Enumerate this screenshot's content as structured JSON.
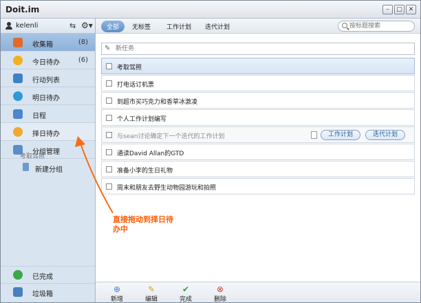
{
  "app": {
    "title": "Doit.im"
  },
  "user": {
    "name": "kelenli"
  },
  "sidebar": {
    "items": [
      {
        "label": "收集箱",
        "count": "(8)",
        "color": "#e06a2b"
      },
      {
        "label": "今日待办",
        "count": "(6)",
        "color": "#f2b01e"
      },
      {
        "label": "行动列表",
        "count": "",
        "color": "#3f7fc8"
      },
      {
        "label": "明日待办",
        "count": "",
        "color": "#2f9ad8"
      },
      {
        "label": "日程",
        "count": "",
        "color": "#4b86cf"
      },
      {
        "label": "择日待办",
        "count": "",
        "color": "#f0a830"
      },
      {
        "label": "分组管理",
        "count": "",
        "color": "#5b8ec7"
      }
    ],
    "sub_item": {
      "label": "新建分组"
    },
    "drag_ghost": "考取驾照",
    "completed": {
      "label": "已完成"
    },
    "trash": {
      "label": "垃圾箱"
    }
  },
  "filters": {
    "tags": [
      "全部",
      "无标签",
      "工作计划",
      "迭代计划"
    ],
    "search_placeholder": "按标题搜索"
  },
  "new_task": {
    "placeholder": "新任务"
  },
  "tasks": [
    {
      "text": "考取驾照"
    },
    {
      "text": "打电话订机票"
    },
    {
      "text": "到超市买巧克力和香草冰激凌"
    },
    {
      "text": "个人工作计划编写"
    },
    {
      "text": "与sean讨论确定下一个迭代的工作计划",
      "tags": [
        "工作计划",
        "迭代计划"
      ]
    },
    {
      "text": "通读David Allan的GTD"
    },
    {
      "text": "准备小李的生日礼物"
    },
    {
      "text": "周末和朋友去野生动物园游玩和拍照"
    }
  ],
  "toolbar": {
    "add": "新增",
    "edit": "编辑",
    "complete": "完成",
    "delete": "删除"
  },
  "annotation": {
    "line1": "直接拖动到择日待",
    "line2": "办中"
  }
}
